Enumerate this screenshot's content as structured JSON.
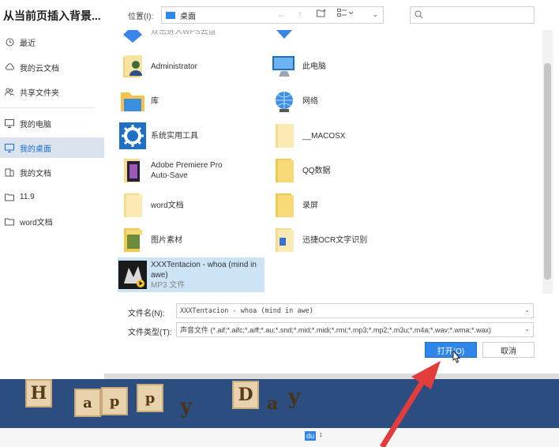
{
  "dialog": {
    "title": "从当前页插入背景..."
  },
  "sidebar": {
    "items": [
      {
        "label": "最近",
        "icon": "clock-icon"
      },
      {
        "label": "我的云文档",
        "icon": "cloud-icon"
      },
      {
        "label": "共享文件夹",
        "icon": "shared-folder-icon"
      },
      {
        "label": "我的电脑",
        "icon": "monitor-icon"
      },
      {
        "label": "我的桌面",
        "icon": "desktop-icon",
        "active": true
      },
      {
        "label": "我的文档",
        "icon": "document-icon"
      },
      {
        "label": "11.9",
        "icon": "folder-icon"
      },
      {
        "label": "word文档",
        "icon": "folder-icon"
      }
    ]
  },
  "topbar": {
    "location_label": "位置(I):",
    "location_value": "桌面",
    "search_placeholder": ""
  },
  "files": [
    {
      "name": "双击进入WPS云盘",
      "icon": "wps-cloud-icon"
    },
    {
      "name": "",
      "icon": "shield-icon"
    },
    {
      "name": "Administrator",
      "icon": "user-folder-icon"
    },
    {
      "name": "此电脑",
      "icon": "computer-icon"
    },
    {
      "name": "库",
      "icon": "library-icon"
    },
    {
      "name": "网络",
      "icon": "network-icon"
    },
    {
      "name": "系统实用工具",
      "icon": "gear-icon"
    },
    {
      "name": "__MACOSX",
      "icon": "folder-icon"
    },
    {
      "name": "Adobe Premiere Pro",
      "name2": "Auto-Save",
      "icon": "folder-icon"
    },
    {
      "name": "QQ数据",
      "icon": "folder-icon"
    },
    {
      "name": "word文档",
      "icon": "folder-icon"
    },
    {
      "name": "录屏",
      "icon": "folder-icon"
    },
    {
      "name": "图片素材",
      "icon": "folder-icon"
    },
    {
      "name": "迅捷OCR文字识别",
      "icon": "folder-icon"
    },
    {
      "name": "XXXTentacion - whoa (mind in",
      "name2": "awe)",
      "type": "MP3 文件",
      "icon": "mp3-file-icon",
      "selected": true
    }
  ],
  "form": {
    "filename_label": "文件名(N):",
    "filename_value": "XXXTentacion - whoa (mind in awe)",
    "filetype_label": "文件类型(T):",
    "filetype_value": "声音文件 (*.aif;*.aifc;*.aiff;*.au;*.snd;*.mid;*.midi;*.rmi;*.mp3;*.mp2;*.m3u;*.m4a;*.wav;*.wma;*.wax)",
    "ok_label": "打开(O)",
    "cancel_label": "取消"
  },
  "background": {
    "banner_letters": [
      "H",
      "a",
      "p",
      "p",
      "y",
      "D",
      "a",
      "y"
    ],
    "bottom_label": "du"
  },
  "colors": {
    "accent": "#2f86e8",
    "selection": "#cde4f7",
    "banner": "#2c4d80",
    "arrow": "#e23c3c"
  }
}
